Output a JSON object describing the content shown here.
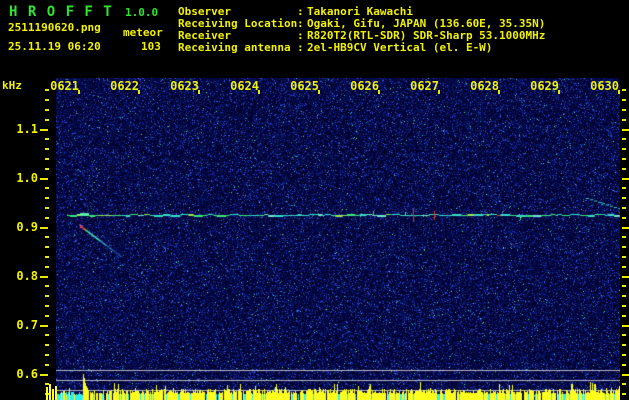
{
  "app": {
    "title": "H R O F F T",
    "version": "1.0.0"
  },
  "file": {
    "name": "2511190620.png",
    "mode": "meteor",
    "datetime": "25.11.19 06:20",
    "count": "103"
  },
  "info": {
    "colon": ":",
    "rows": [
      {
        "label": "Observer",
        "value": "Takanori Kawachi"
      },
      {
        "label": "Receiving Location",
        "value": "Ogaki, Gifu, JAPAN (136.60E, 35.35N)"
      },
      {
        "label": "Receiver",
        "value": "R820T2(RTL-SDR) SDR-Sharp 53.1000MHz"
      },
      {
        "label": "Receiving antenna",
        "value": "2el-HB9CV Vertical (el. E-W)"
      }
    ]
  },
  "axes": {
    "freq_unit": "kHz",
    "freq_labels": [
      "1.1",
      "1.0",
      "0.9",
      "0.8",
      "0.7",
      "0.6"
    ],
    "time_labels": [
      "0621",
      "0622",
      "0623",
      "0624",
      "0625",
      "0626",
      "0627",
      "0628",
      "0629",
      "0630"
    ]
  },
  "colors": {
    "title_green": "#2ee62e",
    "text_yellow": "#f2f200",
    "axis_yellow": "#e8e800",
    "spectro_base": "#000030",
    "carrier_line": "#38dcc8",
    "echo_red": "#d83428",
    "meter_cyan": "#2ef0f0",
    "meter_yellow": "#ffff1e",
    "grid_gray": "#b4b4c4"
  },
  "spectrogram": {
    "carrier_line_khz": 0.92,
    "carrier_line_start_time": "0621",
    "time_span": [
      "0621",
      "0630"
    ],
    "freq_range_khz": [
      0.55,
      1.18
    ],
    "events": [
      {
        "type": "meteor-echo-doppler-trail",
        "time": "0621",
        "khz_from": 0.9,
        "khz_to": 0.84
      },
      {
        "type": "ping",
        "time": "0627",
        "khz": 0.92
      },
      {
        "type": "ping",
        "time": "0627",
        "khz": 0.92
      },
      {
        "type": "meteor-echo-doppler-trail",
        "time": "0630",
        "khz_from": 0.95,
        "khz_to": 0.93
      }
    ]
  }
}
